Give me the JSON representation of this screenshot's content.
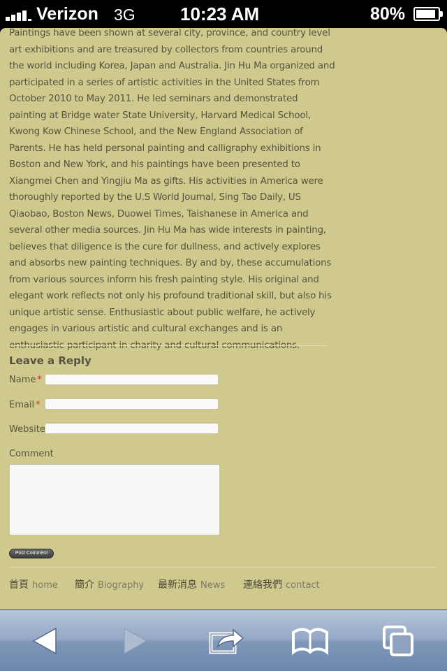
{
  "status_bar": {
    "carrier": "Verizon",
    "network": "3G",
    "time": "10:23 AM",
    "battery": "80%"
  },
  "article": {
    "bio_text": "Paintings have been shown at several city, province, and country level art exhibitions and are treasured by collectors from countries around the world including Korea, Japan and Australia. Jin Hu Ma organized and participated in a series of artistic activities in the United States from October 2010 to May 2011. He led seminars and demonstrated painting at Bridge water State University, Harvard Medical School, Kwong Kow Chinese School, and the New England Association of Parents. He has held personal painting and calligraphy exhibitions in Boston and New York, and his paintings have been presented to Xiangmei Chen and Yingjiu Ma as gifts.  His activities in America were thoroughly reported by the U.S World Journal, Sing Tao Daily, US Qiaobao, Boston News, Duowei Times, Taishanese in America and several other media sources. Jin Hu Ma has wide interests in painting, believes that diligence is the cure for dullness, and actively explores and absorbs new painting techniques. By and by, these accumulations from various sources inform his fresh painting style. His original and elegant work reflects not only his profound traditional skill, but also his unique artistic sense. Enthusiastic about public welfare, he actively engages in various artistic and cultural exchanges and is an enthusiastic participant in charity and cultural communications."
  },
  "reply_form": {
    "heading": "Leave a Reply",
    "name_label": "Name",
    "email_label": "Email",
    "website_label": "Website",
    "comment_label": "Comment",
    "required_mark": "*",
    "name_value": "",
    "email_value": "",
    "website_value": "",
    "comment_value": "",
    "submit_label": "Post Comment"
  },
  "footer_nav": [
    {
      "zh": "首頁",
      "en": "home"
    },
    {
      "zh": "簡介",
      "en": "Biography"
    },
    {
      "zh": "最新消息",
      "en": "News"
    },
    {
      "zh": "連絡我們",
      "en": "contact"
    }
  ],
  "toolbar": {
    "icons": [
      "back-arrow-icon",
      "forward-arrow-icon",
      "share-icon",
      "bookmarks-icon",
      "tabs-icon"
    ]
  },
  "colors": {
    "page_background": "#d0c98e",
    "body_text": "#56533f",
    "required_mark": "#c0392b",
    "toolbar_top": "#b7c6da",
    "toolbar_bottom": "#6d87ab"
  }
}
